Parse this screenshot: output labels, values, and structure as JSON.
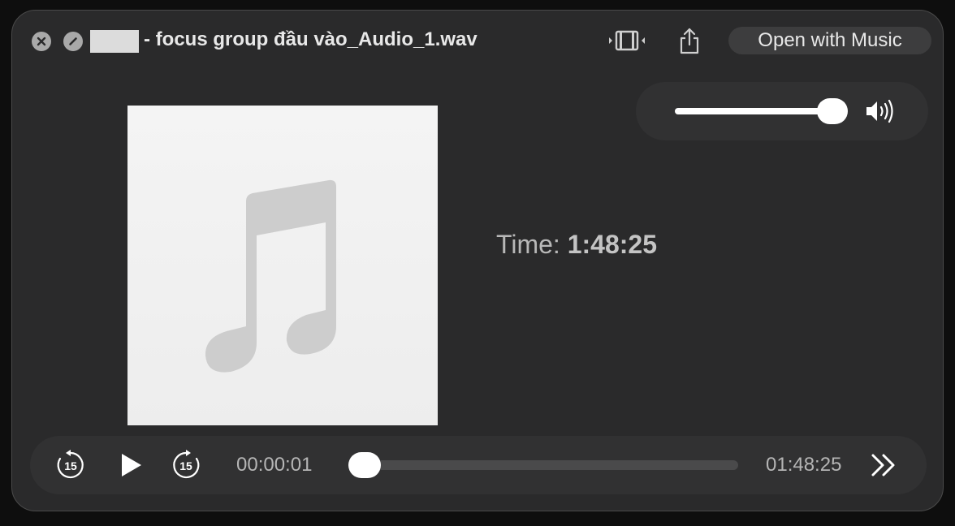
{
  "titlebar": {
    "title": "- focus group đầu vào_Audio_1.wav",
    "open_button_label": "Open with Music",
    "icons": {
      "close": "close-icon",
      "disable": "block-icon",
      "trim": "trim-icon",
      "share": "share-icon"
    }
  },
  "volume": {
    "level": 0.95,
    "icon": "speaker-icon"
  },
  "artwork": {
    "icon": "music-note-icon"
  },
  "info": {
    "time_label": "Time:",
    "time_value": "1:48:25"
  },
  "player": {
    "rewind_label": "15",
    "forward_label": "15",
    "current_time": "00:00:01",
    "duration": "01:48:25",
    "progress": 0.0002,
    "icons": {
      "rewind": "skip-back-15-icon",
      "play": "play-icon",
      "forward": "skip-forward-15-icon",
      "speed": "fast-forward-icon"
    }
  },
  "colors": {
    "window_bg": "#2a2a2b",
    "panel_bg": "#313132",
    "text": "#e8e8e8"
  }
}
